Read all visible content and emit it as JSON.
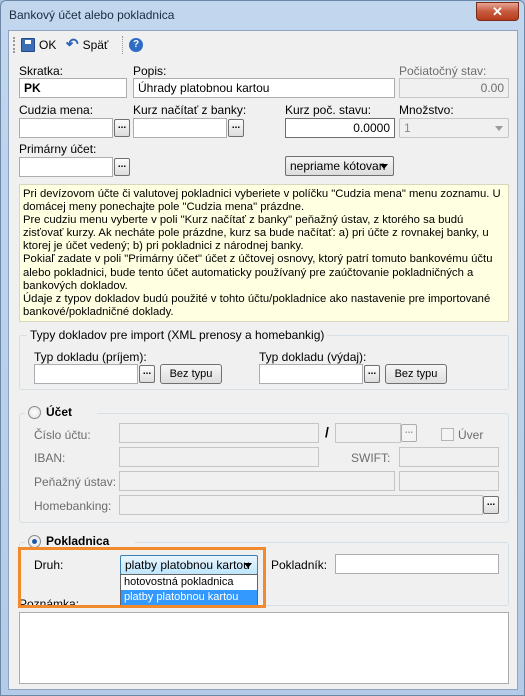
{
  "window": {
    "title": "Bankový účet alebo pokladnica",
    "close_label": "✕"
  },
  "toolbar": {
    "ok_label": "OK",
    "back_label": "Späť",
    "save_icon": "save-icon",
    "undo_icon": "undo-icon",
    "help_icon": "help-icon"
  },
  "form": {
    "skratka_label": "Skratka:",
    "skratka_value": "PK",
    "popis_label": "Popis:",
    "popis_value": "Úhrady platobnou kartou",
    "pociatocny_stav_label": "Počiatočný stav:",
    "pociatocny_stav_value": "0.00",
    "cudzia_mena_label": "Cudzia mena:",
    "cudzia_mena_value": "",
    "kurz_nacitat_label": "Kurz načítať z banky:",
    "kurz_nacitat_value": "",
    "kurz_poc_stavu_label": "Kurz poč. stavu:",
    "kurz_poc_stavu_value": "0.0000",
    "mnozstvo_label": "Množstvo:",
    "mnozstvo_value": "1",
    "primarny_ucet_label": "Primárny účet:",
    "primarny_ucet_value": "",
    "kotovanie_value": "nepriame kótovan",
    "lookup_label": "..."
  },
  "info": [
    "Pri devízovom účte či valutovej pokladnici vyberiete v políčku \"Cudzia mena\" menu zoznamu. U domácej meny ponechajte pole \"Cudzia mena\" prázdne.",
    "Pre cudziu menu vyberte v poli \"Kurz načítať z banky\" peňažný ústav, z ktorého sa budú zisťovať kurzy. Ak necháte pole prázdne, kurz sa bude načítať: a) pri účte z rovnakej banky, u ktorej je účet vedený; b) pri pokladnici z národnej banky.",
    "Pokiaľ zadate v poli \"Primárny účet\" účet z účtovej osnovy, ktorý patrí tomuto bankovému účtu alebo pokladnici, bude tento účet automaticky používaný pre zaúčtovanie pokladničných a bankových dokladov.",
    "Údaje z typov dokladov budú použité v tohto účtu/pokladnice ako nastavenie pre importované bankové/pokladničné doklady."
  ],
  "import_types": {
    "group_title": "Typy dokladov pre import (XML prenosy a homebankig)",
    "prijem_label": "Typ dokladu (príjem):",
    "prijem_value": "",
    "vydaj_label": "Typ dokladu (výdaj):",
    "vydaj_value": "",
    "bez_typu_label": "Bez typu"
  },
  "ucet": {
    "title": "Účet",
    "cislo_uctu_label": "Číslo účtu:",
    "slash": "/",
    "uver_label": "Úver",
    "iban_label": "IBAN:",
    "swift_label": "SWIFT:",
    "penazny_ustav_label": "Peňažný ústav:",
    "homebanking_label": "Homebanking:"
  },
  "pokladnica": {
    "title": "Pokladnica",
    "druh_label": "Druh:",
    "druh_value": "platby platobnou kartou",
    "pokladnik_label": "Pokladník:",
    "pokladnik_value": "",
    "options": [
      "hotovostná pokladnica",
      "platby platobnou kartou"
    ],
    "selected_index": 1
  },
  "poznamka": {
    "label": "Poznámka:"
  },
  "colors": {
    "highlight": "#f08a2c",
    "selection": "#3399ff",
    "info_bg": "#ffffe1"
  }
}
